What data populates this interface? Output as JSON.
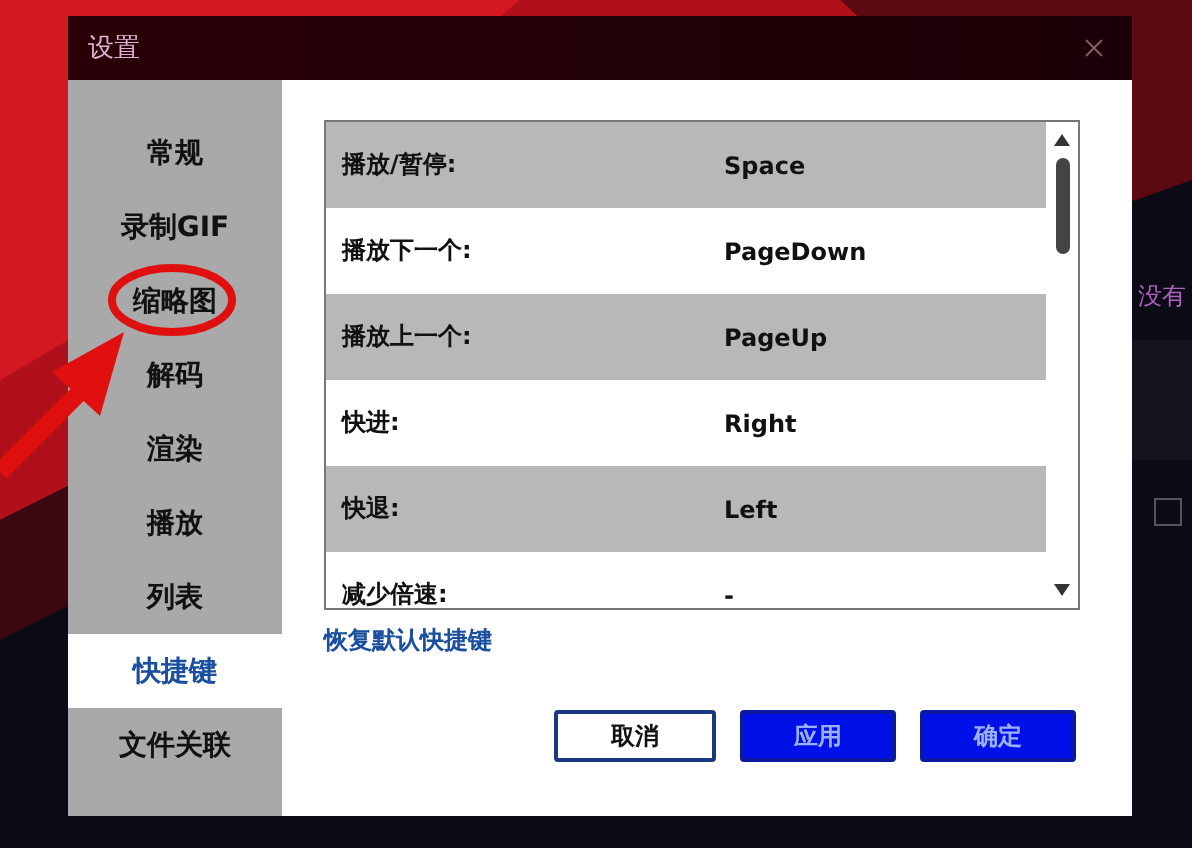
{
  "window": {
    "title": "设置"
  },
  "sidebar": {
    "items": [
      {
        "label": "常规",
        "selected": false
      },
      {
        "label": "录制GIF",
        "selected": false
      },
      {
        "label": "缩略图",
        "selected": false
      },
      {
        "label": "解码",
        "selected": false
      },
      {
        "label": "渲染",
        "selected": false
      },
      {
        "label": "播放",
        "selected": false
      },
      {
        "label": "列表",
        "selected": false
      },
      {
        "label": "快捷键",
        "selected": true
      },
      {
        "label": "文件关联",
        "selected": false
      }
    ]
  },
  "shortcuts": {
    "rows": [
      {
        "action": "播放/暂停:",
        "key": "Space"
      },
      {
        "action": "播放下一个:",
        "key": "PageDown"
      },
      {
        "action": "播放上一个:",
        "key": "PageUp"
      },
      {
        "action": "快进:",
        "key": "Right"
      },
      {
        "action": "快退:",
        "key": "Left"
      },
      {
        "action": "减少倍速:",
        "key": "-"
      }
    ],
    "reset_link": "恢复默认快捷键"
  },
  "buttons": [
    {
      "label": "取消",
      "kind": "secondary"
    },
    {
      "label": "应用",
      "kind": "primary"
    },
    {
      "label": "确定",
      "kind": "primary"
    }
  ],
  "background": {
    "text": "没有"
  }
}
